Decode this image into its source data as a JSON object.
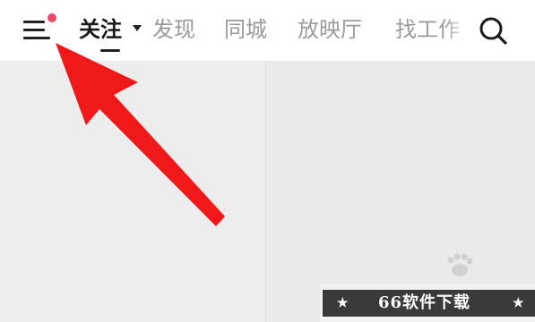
{
  "header": {
    "tabs": [
      {
        "label": "关注",
        "active": true
      },
      {
        "label": "发现",
        "active": false
      },
      {
        "label": "同城",
        "active": false
      },
      {
        "label": "放映厅",
        "active": false
      },
      {
        "label": "找工作",
        "active": false
      }
    ],
    "menu_icon": "hamburger-menu-icon",
    "search_icon": "search-icon",
    "notification_dot_color": "#ee4a67"
  },
  "annotation": {
    "arrow_color": "#f01818"
  },
  "watermark": {
    "banner_text": "66软件下载",
    "star": "★"
  },
  "colors": {
    "active_tab": "#1a1a1a",
    "inactive_tab": "#9a9a9a",
    "content_bg": "#ececec"
  }
}
